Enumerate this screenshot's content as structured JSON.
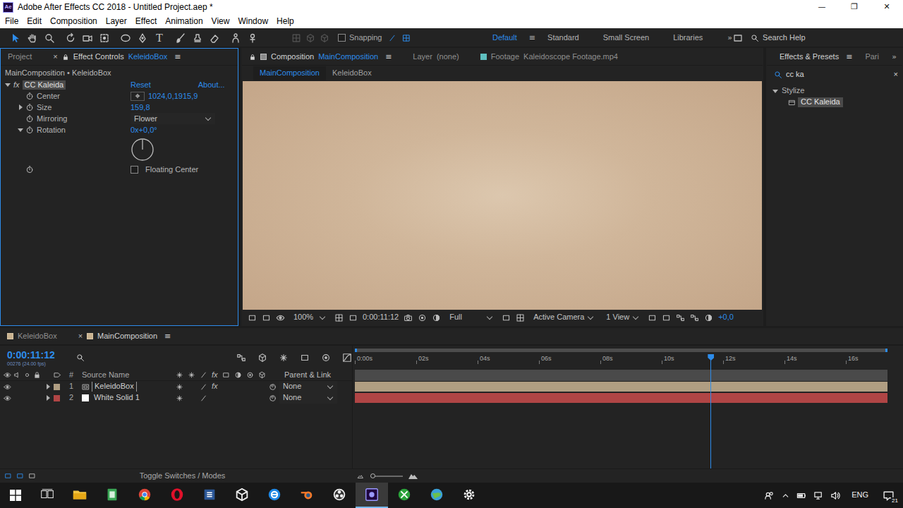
{
  "window": {
    "logo": "Ae",
    "title": "Adobe After Effects CC 2018 - Untitled Project.aep *",
    "controls": [
      "—",
      "❐",
      "✕"
    ]
  },
  "menu": [
    "File",
    "Edit",
    "Composition",
    "Layer",
    "Effect",
    "Animation",
    "View",
    "Window",
    "Help"
  ],
  "toolbar": {
    "tools": [
      {
        "selected": true
      },
      {
        "selected": false
      },
      {
        "selected": false
      },
      {
        "selected": false
      },
      {
        "selected": false
      },
      {
        "selected": false
      },
      {
        "selected": false
      },
      {
        "selected": false
      },
      {
        "selected": false,
        "glyph": "T"
      },
      {
        "selected": false
      },
      {
        "selected": false
      },
      {
        "selected": false
      },
      {
        "selected": false
      },
      {
        "selected": false
      }
    ],
    "snapping": {
      "label": "Snapping",
      "checked": false
    },
    "workspaces": [
      {
        "label": "Default",
        "selected": true
      },
      {
        "label": "Standard",
        "selected": false
      },
      {
        "label": "Small Screen",
        "selected": false
      },
      {
        "label": "Libraries",
        "selected": false
      }
    ],
    "workspace_menu": "≡",
    "more": "»",
    "search": {
      "placeholder": "Search Help"
    }
  },
  "left_panel": {
    "focused": true,
    "tabs": [
      {
        "label": "Project",
        "selected": false
      },
      {
        "label": "Effect Controls",
        "subject": "KeleidoBox",
        "selected": true,
        "close": "×",
        "menu": "≡"
      }
    ]
  },
  "effect_controls": {
    "breadcrumb": "MainComposition • KeleidoBox",
    "effect": {
      "fx": "fx",
      "name": "CC Kaleida",
      "reset": "Reset",
      "about": "About...",
      "expanded": true
    },
    "properties": [
      {
        "kind": "point",
        "label": "Center",
        "value": "1024,0,1915,9"
      },
      {
        "kind": "value",
        "label": "Size",
        "value": "159,8",
        "expanded": false
      },
      {
        "kind": "dropdown",
        "label": "Mirroring",
        "value": "Flower"
      },
      {
        "kind": "angle",
        "label": "Rotation",
        "value": "0x+0,0°",
        "expanded": true,
        "dial": 0
      },
      {
        "kind": "checkbox",
        "label": "Floating Center",
        "checked": false
      }
    ]
  },
  "composition_panel": {
    "tabs": [
      {
        "label": "Composition",
        "subject": "MainComposition",
        "selected": true,
        "menu": "≡"
      },
      {
        "label": "Layer",
        "subject": "(none)",
        "selected": false
      },
      {
        "label": "Footage",
        "subject": "Kaleidoscope Footage.mp4",
        "selected": false
      }
    ],
    "subtabs": [
      {
        "label": "MainComposition",
        "selected": true
      },
      {
        "label": "KeleidoBox",
        "selected": false
      }
    ],
    "footer": {
      "zoom": "100%",
      "time": "0:00:11:12",
      "resolution": "Full",
      "camera": "Active Camera",
      "views": "1 View",
      "exposure": "+0,0"
    }
  },
  "effects_panel": {
    "tabs": [
      {
        "label": "Effects & Presets",
        "selected": true,
        "menu": "≡"
      },
      {
        "label": "Pari",
        "selected": false
      }
    ],
    "more": "»",
    "search": {
      "value": "cc ka",
      "clear": "×"
    },
    "tree": [
      {
        "label": "Stylize",
        "expanded": true,
        "children": [
          {
            "label": "CC Kaleida",
            "selected": true
          }
        ]
      }
    ]
  },
  "timeline": {
    "tabs": [
      {
        "label": "KeleidoBox",
        "selected": false
      },
      {
        "label": "MainComposition",
        "selected": true,
        "close": "×",
        "menu": "≡"
      }
    ],
    "time": "0:00:11:12",
    "frames": "00276 (24.00 fps)",
    "columns": {
      "num": "#",
      "source": "Source Name",
      "fx": "fx",
      "parent": "Parent & Link"
    },
    "ruler": {
      "ticks": [
        "0:00s",
        "02s",
        "04s",
        "06s",
        "08s",
        "10s",
        "12s",
        "14s",
        "16s"
      ],
      "playhead": 0.668
    },
    "layers": [
      {
        "num": "1",
        "name": "KeleidoBox",
        "parent": "None",
        "color": "#b09e82",
        "kind": "precomp",
        "selected": true,
        "visible": true,
        "expanded": false,
        "fx": "fx"
      },
      {
        "num": "2",
        "name": "White Solid 1",
        "parent": "None",
        "color": "#b04545",
        "kind": "solid",
        "selected": false,
        "visible": true,
        "expanded": false
      }
    ],
    "footer": "Toggle Switches / Modes"
  },
  "taskbar": {
    "apps": [
      {
        "selected": false
      },
      {
        "selected": false
      },
      {
        "selected": false
      },
      {
        "selected": false
      },
      {
        "selected": false
      },
      {
        "selected": false
      },
      {
        "selected": false
      },
      {
        "selected": false
      },
      {
        "selected": false
      },
      {
        "selected": false
      },
      {
        "selected": true
      },
      {
        "selected": false
      },
      {
        "selected": false
      },
      {
        "selected": false
      }
    ],
    "tray": {
      "language": "ENG",
      "notifications": "21"
    }
  }
}
